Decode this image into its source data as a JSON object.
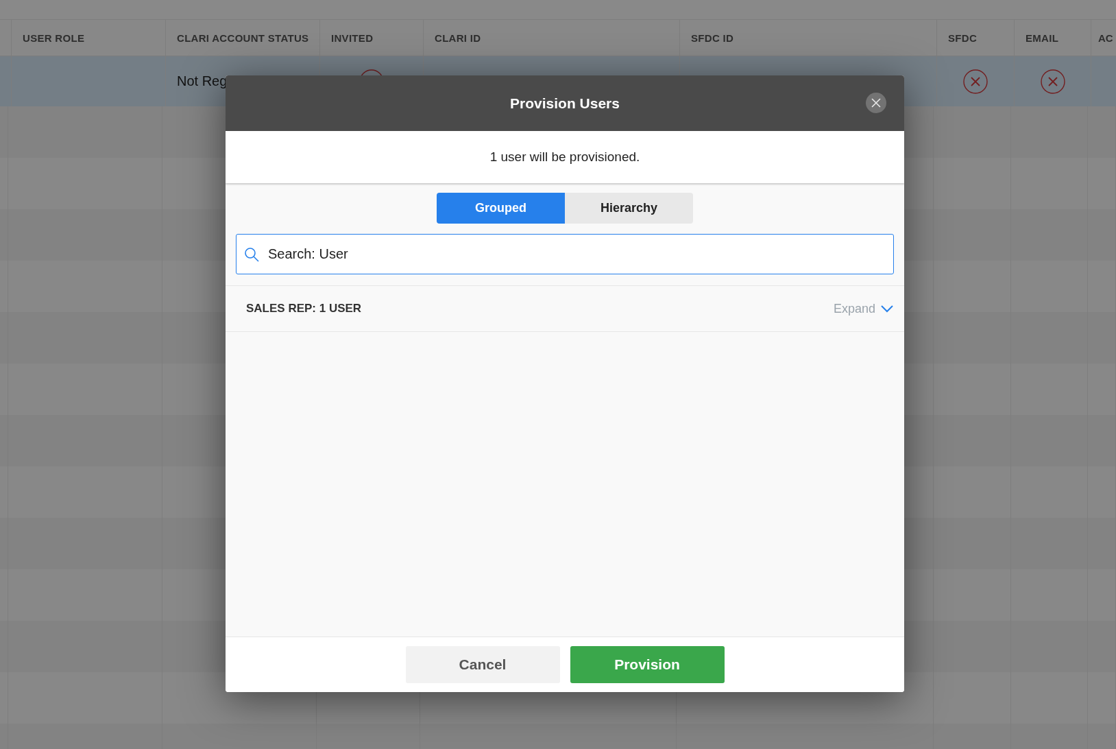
{
  "table": {
    "columns": [
      {},
      {
        "label": "USER ROLE"
      },
      {
        "label": "CLARI ACCOUNT STATUS"
      },
      {
        "label": "INVITED"
      },
      {
        "label": "CLARI ID"
      },
      {
        "label": "SFDC ID"
      },
      {
        "label": "SFDC"
      },
      {
        "label": "EMAIL"
      },
      {
        "label": "AC"
      }
    ],
    "rows": [
      {
        "selected": true,
        "account_status": "Not Reg",
        "invited": false,
        "sfdc": false,
        "email": false
      }
    ]
  },
  "dialog": {
    "title": "Provision Users",
    "message": "1 user will be provisioned.",
    "tabs": [
      {
        "label": "Grouped",
        "selected": true
      },
      {
        "label": "Hierarchy",
        "selected": false
      }
    ],
    "search": {
      "value": "Search: User"
    },
    "groups": [
      {
        "label": "SALES REP: 1 USER",
        "expand_label": "Expand",
        "expanded": false
      }
    ],
    "buttons": [
      {
        "label": "Cancel",
        "kind": "secondary"
      },
      {
        "label": "Provision",
        "kind": "primary"
      }
    ]
  }
}
